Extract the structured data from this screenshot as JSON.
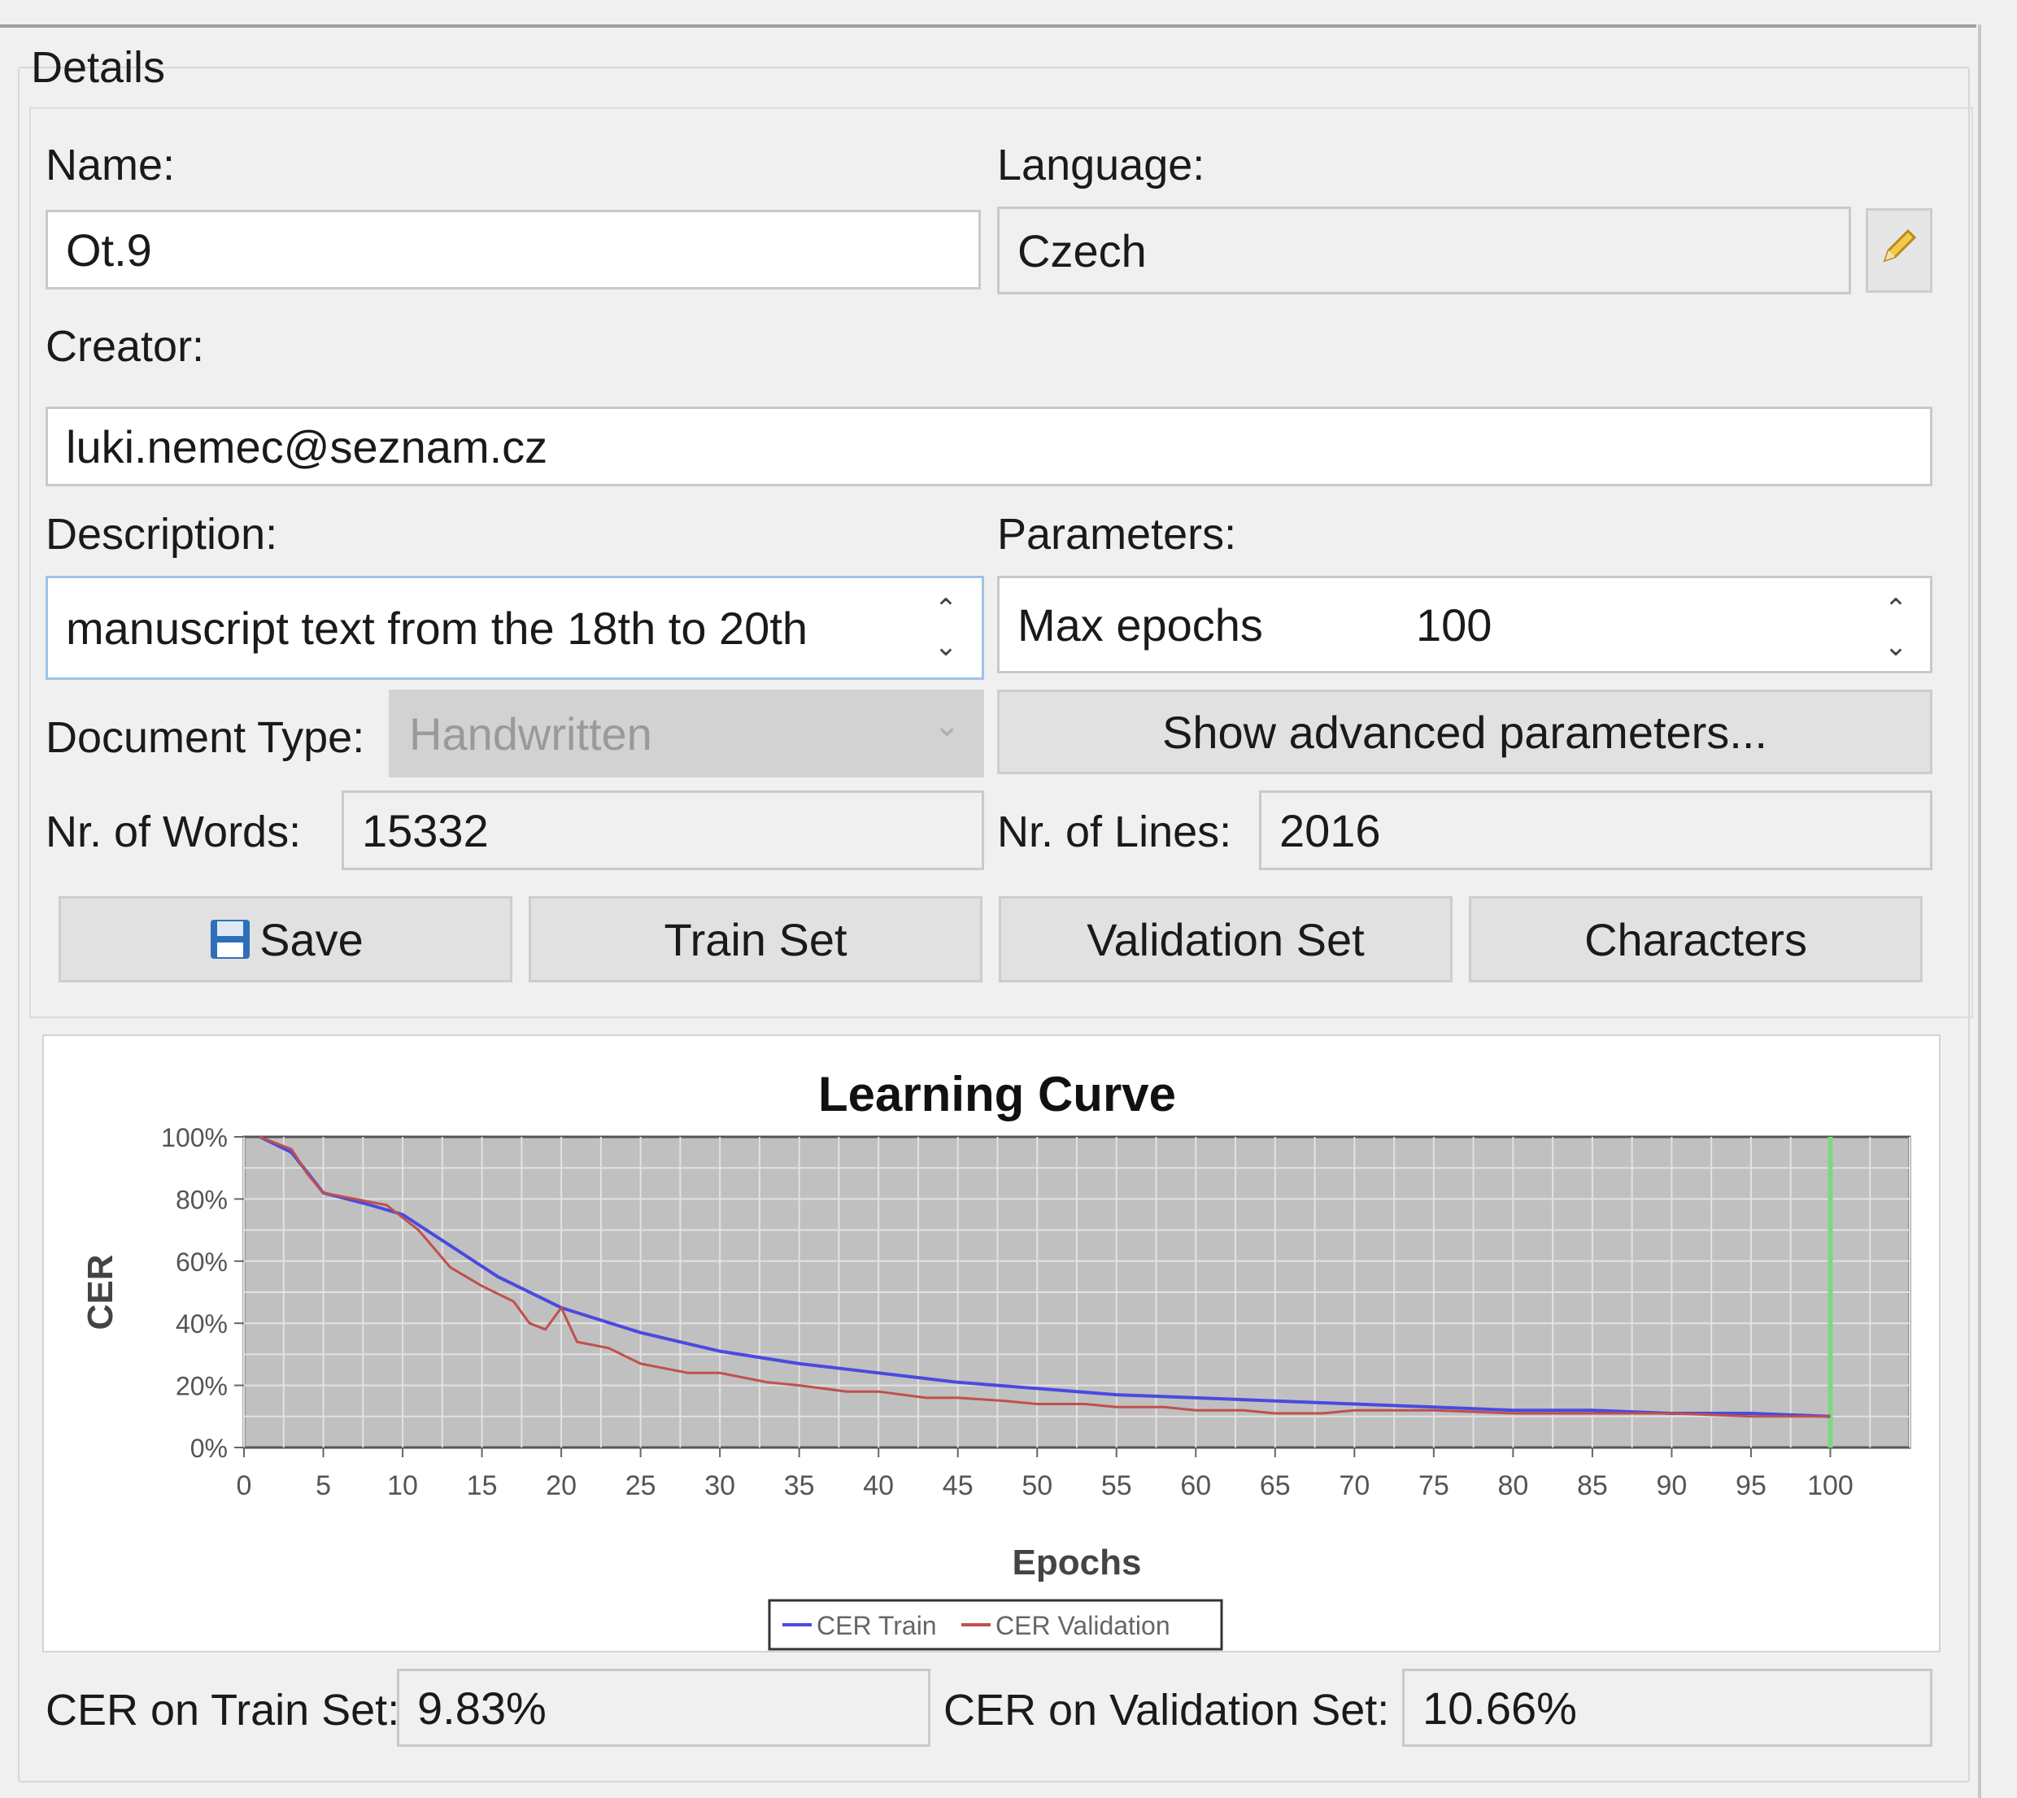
{
  "details": {
    "group_title": "Details",
    "name_label": "Name:",
    "name_value": "Ot.9",
    "language_label": "Language:",
    "language_value": "Czech",
    "creator_label": "Creator:",
    "creator_value": "luki.nemec@seznam.cz",
    "description_label": "Description:",
    "description_value": "manuscript text from the 18th to 20th",
    "parameters_label": "Parameters:",
    "param_name": "Max epochs",
    "param_value": "100",
    "doctype_label": "Document Type:",
    "doctype_value": "Handwritten",
    "advanced_button": "Show advanced parameters...",
    "words_label": "Nr. of Words:",
    "words_value": "15332",
    "lines_label": "Nr. of Lines:",
    "lines_value": "2016",
    "save_button": "Save",
    "train_set_button": "Train Set",
    "validation_set_button": "Validation Set",
    "characters_button": "Characters",
    "cer_train_label": "CER on Train Set:",
    "cer_train_value": "9.83%",
    "cer_val_label": "CER on Validation Set:",
    "cer_val_value": "10.66%"
  },
  "icons": {
    "edit": "pencil-icon",
    "save": "floppy-disk-icon",
    "spin": "spin-arrows-icon"
  },
  "colors": {
    "train": "#4a4adf",
    "validation": "#c0504d",
    "marker": "#7fd87f",
    "plot_bg": "#c0c0c0"
  },
  "chart_data": {
    "type": "line",
    "title": "Learning Curve",
    "xlabel": "Epochs",
    "ylabel": "CER",
    "xlim": [
      0,
      105
    ],
    "ylim": [
      0,
      100
    ],
    "x_ticks": [
      "0",
      "5",
      "10",
      "15",
      "20",
      "25",
      "30",
      "35",
      "40",
      "45",
      "50",
      "55",
      "60",
      "65",
      "70",
      "75",
      "80",
      "85",
      "90",
      "95",
      "100"
    ],
    "y_ticks": [
      "0%",
      "20%",
      "40%",
      "60%",
      "80%",
      "100%"
    ],
    "grid": true,
    "legend": "bottom-center",
    "marker_epoch": 100,
    "series": [
      {
        "name": "CER Train",
        "x": [
          1,
          3,
          5,
          8,
          10,
          13,
          16,
          20,
          25,
          30,
          35,
          40,
          45,
          50,
          55,
          60,
          65,
          70,
          75,
          80,
          85,
          90,
          95,
          100
        ],
        "y": [
          100,
          95,
          82,
          78,
          75,
          65,
          55,
          45,
          37,
          31,
          27,
          24,
          21,
          19,
          17,
          16,
          15,
          14,
          13,
          12,
          12,
          11,
          11,
          10
        ]
      },
      {
        "name": "CER Validation",
        "x": [
          1,
          3,
          4,
          5,
          7,
          9,
          11,
          13,
          15,
          17,
          18,
          19,
          20,
          21,
          23,
          25,
          28,
          30,
          33,
          35,
          38,
          40,
          43,
          45,
          48,
          50,
          53,
          55,
          58,
          60,
          63,
          65,
          68,
          70,
          75,
          80,
          85,
          90,
          95,
          100
        ],
        "y": [
          100,
          96,
          88,
          82,
          80,
          78,
          70,
          58,
          52,
          47,
          40,
          38,
          45,
          34,
          32,
          27,
          24,
          24,
          21,
          20,
          18,
          18,
          16,
          16,
          15,
          14,
          14,
          13,
          13,
          12,
          12,
          11,
          11,
          12,
          12,
          11,
          11,
          11,
          10,
          10
        ]
      }
    ]
  }
}
